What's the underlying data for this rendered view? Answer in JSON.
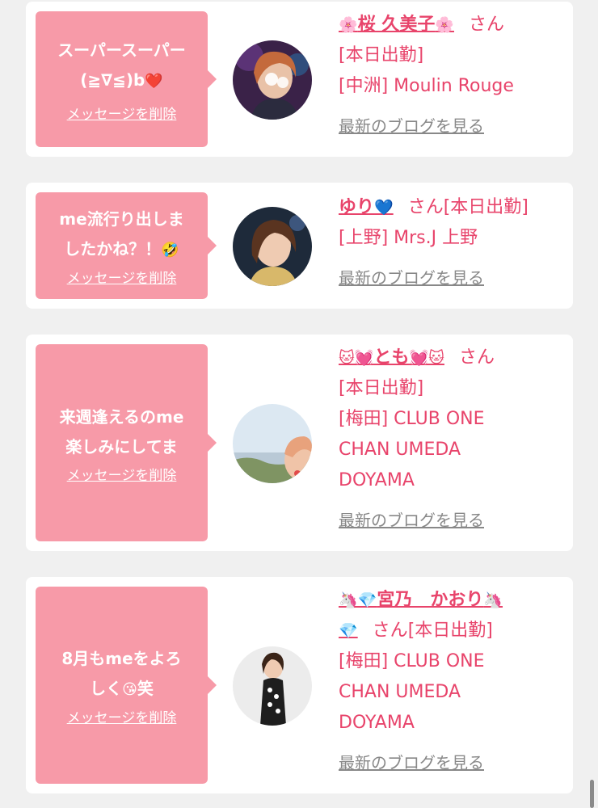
{
  "cards": [
    {
      "message_lines": [
        "スーパースーパー",
        "(≧∇≦)b"
      ],
      "message_emoji": "❤️",
      "delete_label": "メッセージを削除",
      "name_prefix": "🌸",
      "name": "桜 久美子",
      "name_suffix": "🌸",
      "san": "さん",
      "status": "[本日出勤]",
      "shop": "[中洲] Moulin Rouge",
      "blog_label": "最新のブログを見る"
    },
    {
      "message_lines": [
        "me流行り出しま",
        "したかね？！"
      ],
      "message_emoji": "🤣",
      "delete_label": "メッセージを削除",
      "name": "ゆり",
      "name_suffix": "💙",
      "san": "さん",
      "status": "[本日出勤]",
      "shop": "[上野] Mrs.J 上野",
      "blog_label": "最新のブログを見る"
    },
    {
      "message_lines": [
        "来週逢えるのme",
        "楽しみにしてま"
      ],
      "delete_label": "メッセージを削除",
      "name_prefix": "🐱💓",
      "name": "とも",
      "name_suffix": "💓🐱",
      "san": "さん",
      "status": "[本日出勤]",
      "shop_lines": [
        "[梅田] CLUB ONE",
        "CHAN UMEDA",
        "DOYAMA"
      ],
      "blog_label": "最新のブログを見る"
    },
    {
      "message_lines": [
        "8月もmeをよろ",
        "しく"
      ],
      "message_emoji": "😘",
      "message_tail": "笑",
      "delete_label": "メッセージを削除",
      "name_prefix": "🦄💎",
      "name": "宮乃　かおり",
      "name_suffix": "🦄",
      "name_line2": "💎",
      "san": "さん",
      "status": "[本日出勤]",
      "shop_lines": [
        "[梅田] CLUB ONE",
        "CHAN UMEDA",
        "DOYAMA"
      ],
      "blog_label": "最新のブログを見る"
    }
  ],
  "colors": {
    "bubble": "#f79aa8",
    "accent": "#e8446b",
    "link_gray": "#888888",
    "background": "#f0f0f0"
  }
}
